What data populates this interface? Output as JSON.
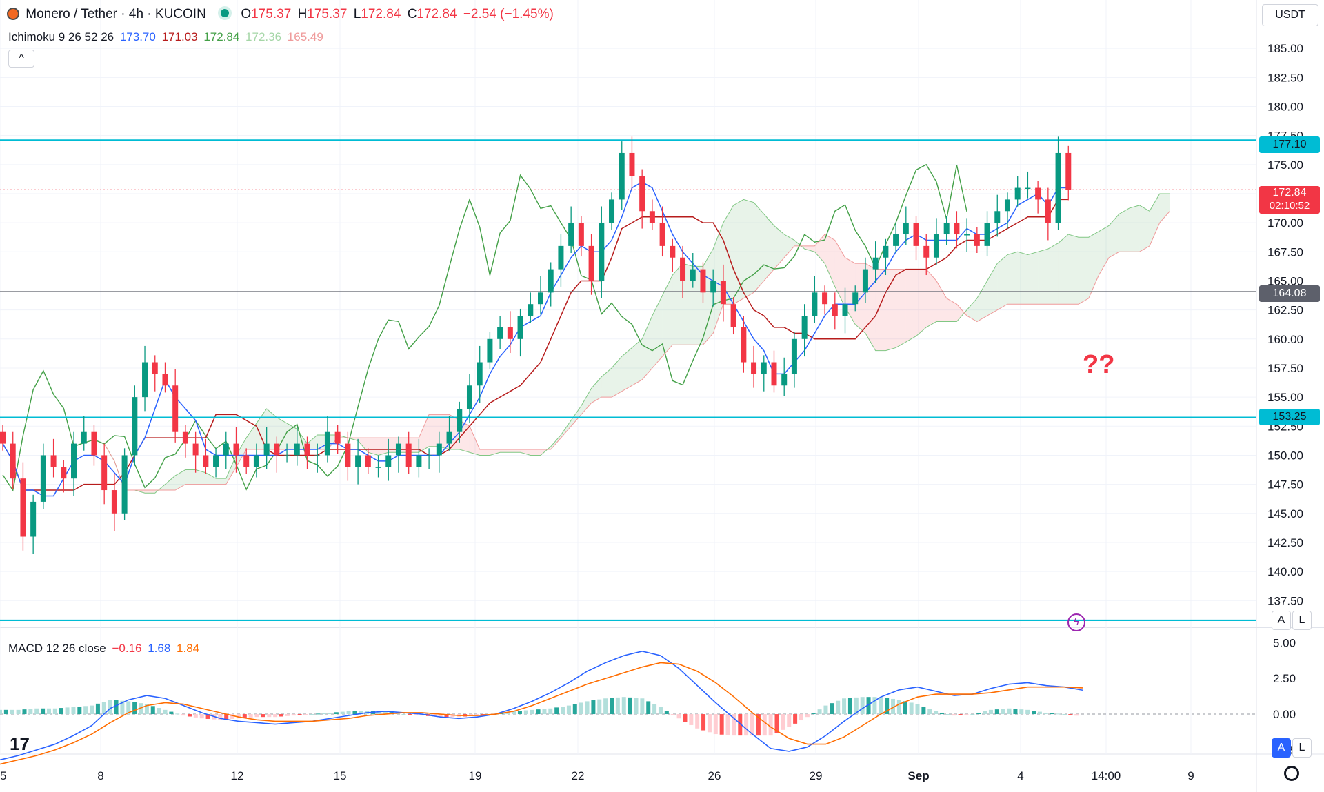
{
  "header": {
    "symbol": "Monero / Tether · 4h · KUCOIN",
    "o_label": "O",
    "o_value": "175.37",
    "h_label": "H",
    "h_value": "175.37",
    "l_label": "L",
    "l_value": "172.84",
    "c_label": "C",
    "c_value": "172.84",
    "change": "−2.54 (−1.45%)",
    "currency": "USDT"
  },
  "ichimoku": {
    "label": "Ichimoku 9 26 52 26",
    "values": [
      "173.70",
      "171.03",
      "172.84",
      "172.36",
      "165.49"
    ],
    "colors": [
      "#2962ff",
      "#b71c1c",
      "#43a047",
      "#a5d6a7",
      "#ef9a9a"
    ]
  },
  "macd": {
    "label": "MACD 12 26 close",
    "values": [
      "−0.16",
      "1.68",
      "1.84"
    ],
    "colors": [
      "#f23645",
      "#2962ff",
      "#ff6d00"
    ]
  },
  "annotation": {
    "text": "??",
    "color": "#f23645"
  },
  "price_tags": {
    "resistance": "177.10",
    "current": "172.84",
    "countdown": "02:10:52",
    "mid": "164.08",
    "support": "153.25"
  },
  "buttons": {
    "collapse": "^",
    "auto": "A",
    "log": "L"
  },
  "colors": {
    "up": "#089981",
    "down": "#f23645",
    "level_line": "#00bcd4",
    "tenkan": "#2962ff",
    "kijun": "#b71c1c",
    "chikou": "#43a047",
    "cloud_bull": "#43a047",
    "cloud_bear": "#f23645"
  },
  "chart_data": [
    {
      "type": "candlestick",
      "title": "Monero / Tether · 4h · KUCOIN",
      "y_axis": {
        "range": [
          135.5,
          187.5
        ],
        "ticks": [
          "185.00",
          "182.50",
          "180.00",
          "177.50",
          "175.00",
          "172.50",
          "170.00",
          "167.50",
          "165.00",
          "162.50",
          "160.00",
          "157.50",
          "155.00",
          "152.50",
          "150.00",
          "147.50",
          "145.00",
          "142.50",
          "140.00",
          "137.50"
        ]
      },
      "x_axis": {
        "ticks": [
          "5",
          "8",
          "12",
          "15",
          "19",
          "22",
          "26",
          "29",
          "Sep",
          "4",
          "14:00",
          "9"
        ]
      },
      "horizontal_levels": [
        177.1,
        164.08,
        153.25,
        135.8
      ],
      "close_series_approx": [
        151,
        148,
        143,
        146,
        150,
        149,
        148,
        151,
        152,
        150,
        147,
        145,
        150,
        155,
        158,
        157,
        156,
        152,
        151,
        150,
        149,
        150,
        151,
        150,
        149,
        150,
        151,
        150,
        150,
        151,
        150,
        150,
        152,
        151,
        149,
        150,
        149,
        149,
        150,
        151,
        149,
        150,
        150,
        151,
        152,
        154,
        156,
        158,
        160,
        161,
        160,
        162,
        163,
        164,
        166,
        168,
        170,
        168,
        165,
        170,
        172,
        176,
        174,
        171,
        170,
        168,
        167,
        165,
        166,
        164,
        165,
        163,
        161,
        158,
        157,
        158,
        156,
        157,
        160,
        162,
        164,
        163,
        162,
        163,
        164,
        166,
        167,
        168,
        169,
        170,
        168,
        167,
        169,
        170,
        169,
        169,
        168,
        170,
        171,
        172,
        173,
        173,
        172,
        170,
        176,
        172.84
      ],
      "ichimoku_last": {
        "tenkan": 173.7,
        "kijun": 171.03,
        "chikou": 172.84,
        "span_a": 172.36,
        "span_b": 165.49
      }
    },
    {
      "type": "bar",
      "title": "MACD 12 26 close",
      "y_axis": {
        "range": [
          -2.7,
          5.6
        ],
        "ticks": [
          "5.00",
          "2.50",
          "0.00",
          "−2.50"
        ]
      },
      "series": [
        {
          "name": "histogram",
          "last": -0.16
        },
        {
          "name": "macd",
          "last": 1.68
        },
        {
          "name": "signal",
          "last": 1.84
        }
      ],
      "macd_line_approx": [
        -3.2,
        -2.9,
        -2.5,
        -2.1,
        -1.5,
        -0.8,
        0.4,
        1.0,
        1.3,
        1.1,
        0.6,
        0.1,
        -0.3,
        -0.5,
        -0.6,
        -0.7,
        -0.6,
        -0.5,
        -0.3,
        -0.1,
        0.1,
        0.2,
        0.1,
        0.0,
        -0.2,
        -0.3,
        -0.2,
        0.0,
        0.4,
        0.9,
        1.5,
        2.2,
        3.0,
        3.6,
        4.1,
        4.4,
        4.1,
        3.2,
        2.0,
        0.8,
        -0.3,
        -1.4,
        -2.4,
        -2.6,
        -2.3,
        -1.5,
        -0.5,
        0.4,
        1.2,
        1.7,
        1.9,
        1.6,
        1.3,
        1.4,
        1.8,
        2.1,
        2.2,
        2.0,
        1.9,
        1.68
      ],
      "signal_line_approx": [
        -3.5,
        -3.2,
        -2.9,
        -2.5,
        -2.0,
        -1.4,
        -0.6,
        0.1,
        0.6,
        0.8,
        0.7,
        0.4,
        0.1,
        -0.2,
        -0.4,
        -0.5,
        -0.5,
        -0.5,
        -0.4,
        -0.3,
        -0.1,
        0.0,
        0.1,
        0.1,
        0.0,
        -0.1,
        -0.1,
        0.0,
        0.2,
        0.6,
        1.1,
        1.6,
        2.1,
        2.5,
        2.9,
        3.3,
        3.6,
        3.5,
        3.0,
        2.2,
        1.2,
        0.1,
        -0.9,
        -1.7,
        -2.1,
        -2.1,
        -1.6,
        -0.8,
        0.0,
        0.7,
        1.2,
        1.4,
        1.4,
        1.4,
        1.5,
        1.7,
        1.9,
        1.9,
        1.9,
        1.84
      ]
    }
  ]
}
